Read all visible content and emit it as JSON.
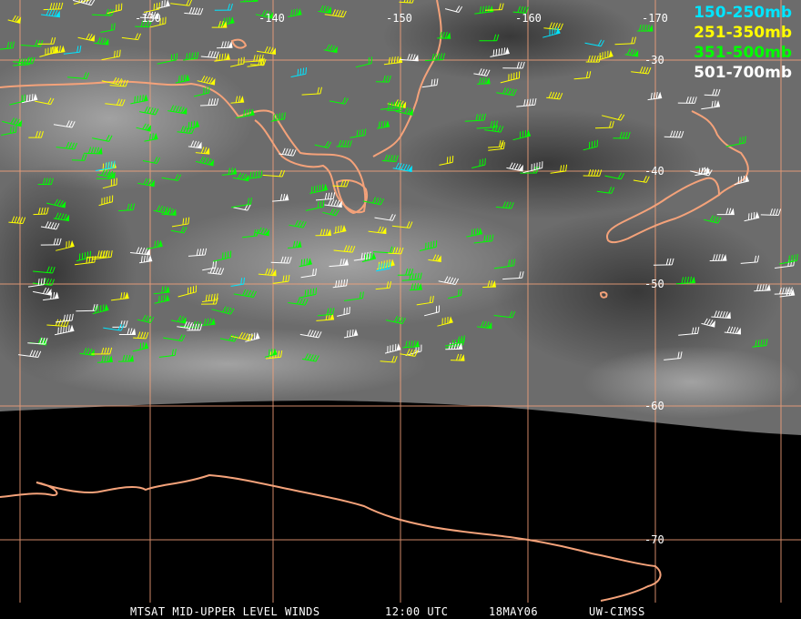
{
  "map": {
    "longitude_labels": [
      {
        "text": "-130",
        "color": "#ffffff"
      },
      {
        "text": "-140",
        "color": "#ffffff"
      },
      {
        "text": "-150",
        "color": "#ffffff"
      },
      {
        "text": "-160",
        "color": "#ffffff"
      },
      {
        "text": "-170",
        "color": "#ffffff"
      }
    ],
    "latitude_labels": [
      {
        "text": "-30"
      },
      {
        "text": "-40"
      },
      {
        "text": "-50"
      },
      {
        "text": "-60"
      },
      {
        "text": "-70"
      }
    ],
    "colors": {
      "grid": "#f4a27a",
      "coast": "#f4a27a",
      "imagery_light": "#8a8a8a",
      "imagery_dark": "#4a4a4a",
      "background": "#000000"
    }
  },
  "legend": [
    {
      "label": "150-250mb",
      "color": "#00e5ff"
    },
    {
      "label": "251-350mb",
      "color": "#ffff00"
    },
    {
      "label": "351-500mb",
      "color": "#00ff00"
    },
    {
      "label": "501-700mb",
      "color": "#ffffff"
    }
  ],
  "footer": {
    "product": "MTSAT MID-UPPER LEVEL WINDS",
    "time": "12:00 UTC",
    "date": "18MAY06",
    "source": "UW-CIMSS"
  }
}
